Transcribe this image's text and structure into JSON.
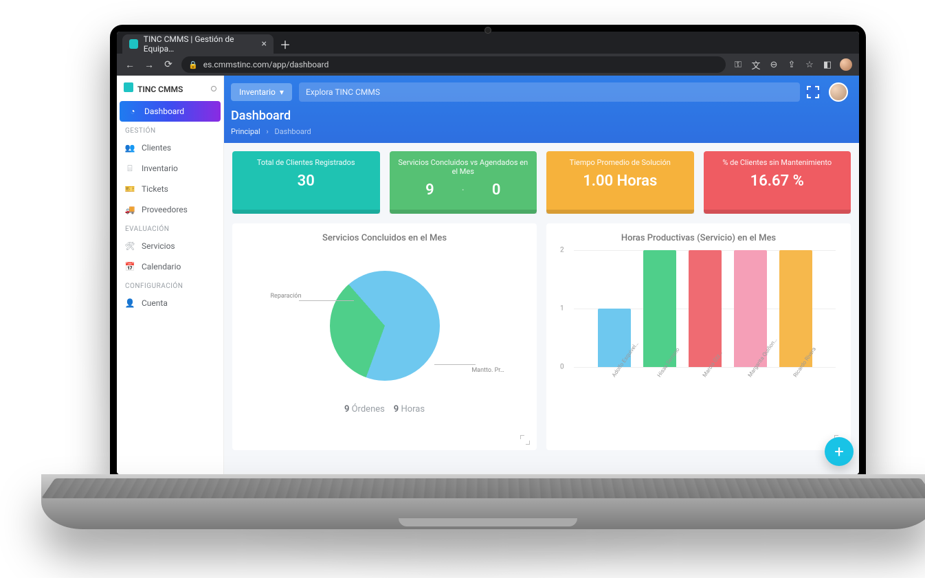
{
  "browser": {
    "tab_title": "TINC CMMS | Gestión de Equipa…",
    "url": "es.cmmstinc.com/app/dashboard"
  },
  "brand": "TINC CMMS",
  "topbar": {
    "btn_inventario": "Inventario",
    "search_placeholder": "Explora TINC CMMS"
  },
  "page": {
    "title": "Dashboard",
    "crumb_root": "Principal",
    "crumb_here": "Dashboard"
  },
  "sidebar": {
    "sections": {
      "gestion": "GESTIÓN",
      "evaluacion": "EVALUACIÓN",
      "config": "CONFIGURACIÓN"
    },
    "items": {
      "dashboard": "Dashboard",
      "clientes": "Clientes",
      "inventario": "Inventario",
      "tickets": "Tickets",
      "proveedores": "Proveedores",
      "servicios": "Servicios",
      "calendario": "Calendario",
      "cuenta": "Cuenta"
    }
  },
  "kpi": {
    "k1": {
      "title": "Total de Clientes Registrados",
      "value": "30"
    },
    "k2": {
      "title": "Servicios Concluidos vs Agendados en el Mes",
      "v1": "9",
      "v2": "0"
    },
    "k3": {
      "title": "Tiempo Promedio de Solución",
      "value": "1.00 Horas"
    },
    "k4": {
      "title": "% de Clientes sin Mantenimiento",
      "value": "16.67 %"
    }
  },
  "panel1": {
    "title": "Servicios Concluidos en el Mes",
    "label_a": "Reparación",
    "label_b": "Mantto. Pr…",
    "stats_n1": "9",
    "stats_t1": "Órdenes",
    "stats_n2": "9",
    "stats_t2": "Horas"
  },
  "panel2": {
    "title": "Horas Productivas (Servicio) en el Mes"
  },
  "chart_data": [
    {
      "type": "pie",
      "title": "Servicios Concluidos en el Mes",
      "series": [
        {
          "name": "Reparación",
          "value": 33,
          "color": "#4fcf8a"
        },
        {
          "name": "Mantto. Pr…",
          "value": 67,
          "color": "#6ec8ef"
        }
      ],
      "footer": "9 Órdenes · 9 Horas"
    },
    {
      "type": "bar",
      "title": "Horas Productivas (Servicio) en el Mes",
      "ylabel": "",
      "ylim": [
        0,
        2
      ],
      "yticks": [
        0,
        1,
        2
      ],
      "categories": [
        "Adolfo Esquivel…",
        "Hisae Serrano",
        "Marcia Gtz…",
        "Margarita Quiñon…",
        "Ricardo Rivera"
      ],
      "values": [
        1,
        2,
        2,
        2,
        2
      ],
      "colors": [
        "#6ec8ef",
        "#4fcf8a",
        "#ef6b72",
        "#f59fb7",
        "#f6b84c"
      ]
    }
  ]
}
